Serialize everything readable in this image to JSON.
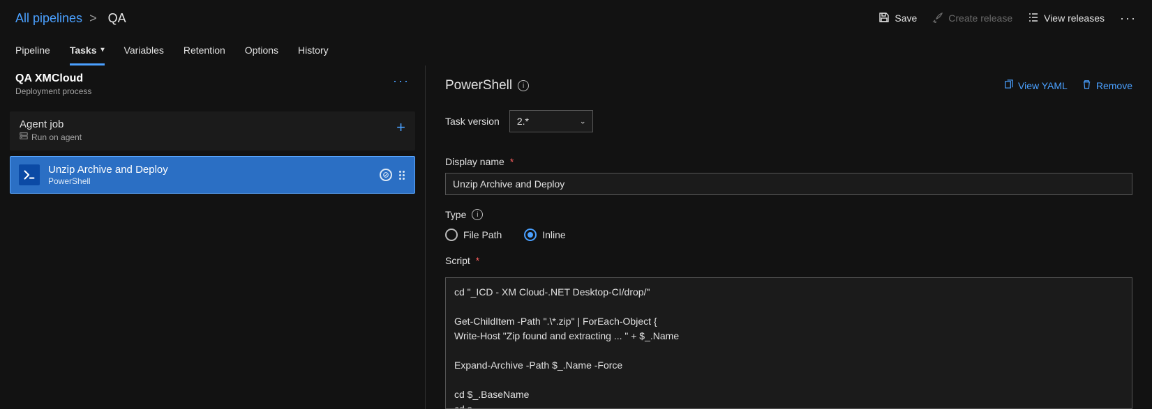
{
  "breadcrumb": {
    "root": "All pipelines",
    "sep": ">",
    "current": "QA"
  },
  "topActions": {
    "save": "Save",
    "createRelease": "Create release",
    "viewReleases": "View releases"
  },
  "tabs": {
    "pipeline": "Pipeline",
    "tasks": "Tasks",
    "variables": "Variables",
    "retention": "Retention",
    "options": "Options",
    "history": "History"
  },
  "stage": {
    "title": "QA XMCloud",
    "subtitle": "Deployment process"
  },
  "job": {
    "title": "Agent job",
    "subtitle": "Run on agent"
  },
  "task": {
    "title": "Unzip Archive and Deploy",
    "subtitle": "PowerShell"
  },
  "rightHeader": {
    "title": "PowerShell",
    "viewYaml": "View YAML",
    "remove": "Remove"
  },
  "fields": {
    "taskVersionLabel": "Task version",
    "taskVersionValue": "2.*",
    "displayNameLabel": "Display name",
    "displayNameValue": "Unzip Archive and Deploy",
    "typeLabel": "Type",
    "typeFilePath": "File Path",
    "typeInline": "Inline",
    "scriptLabel": "Script",
    "scriptValue": "cd \"_ICD - XM Cloud-.NET Desktop-CI/drop/\"\n\nGet-ChildItem -Path \".\\*.zip\" | ForEach-Object {\nWrite-Host \"Zip found and extracting ... \" + $_.Name\n\nExpand-Archive -Path $_.Name -Force\n\ncd $_.BaseName\ncd s\nWrite-Host \"Run release script ... \""
  }
}
